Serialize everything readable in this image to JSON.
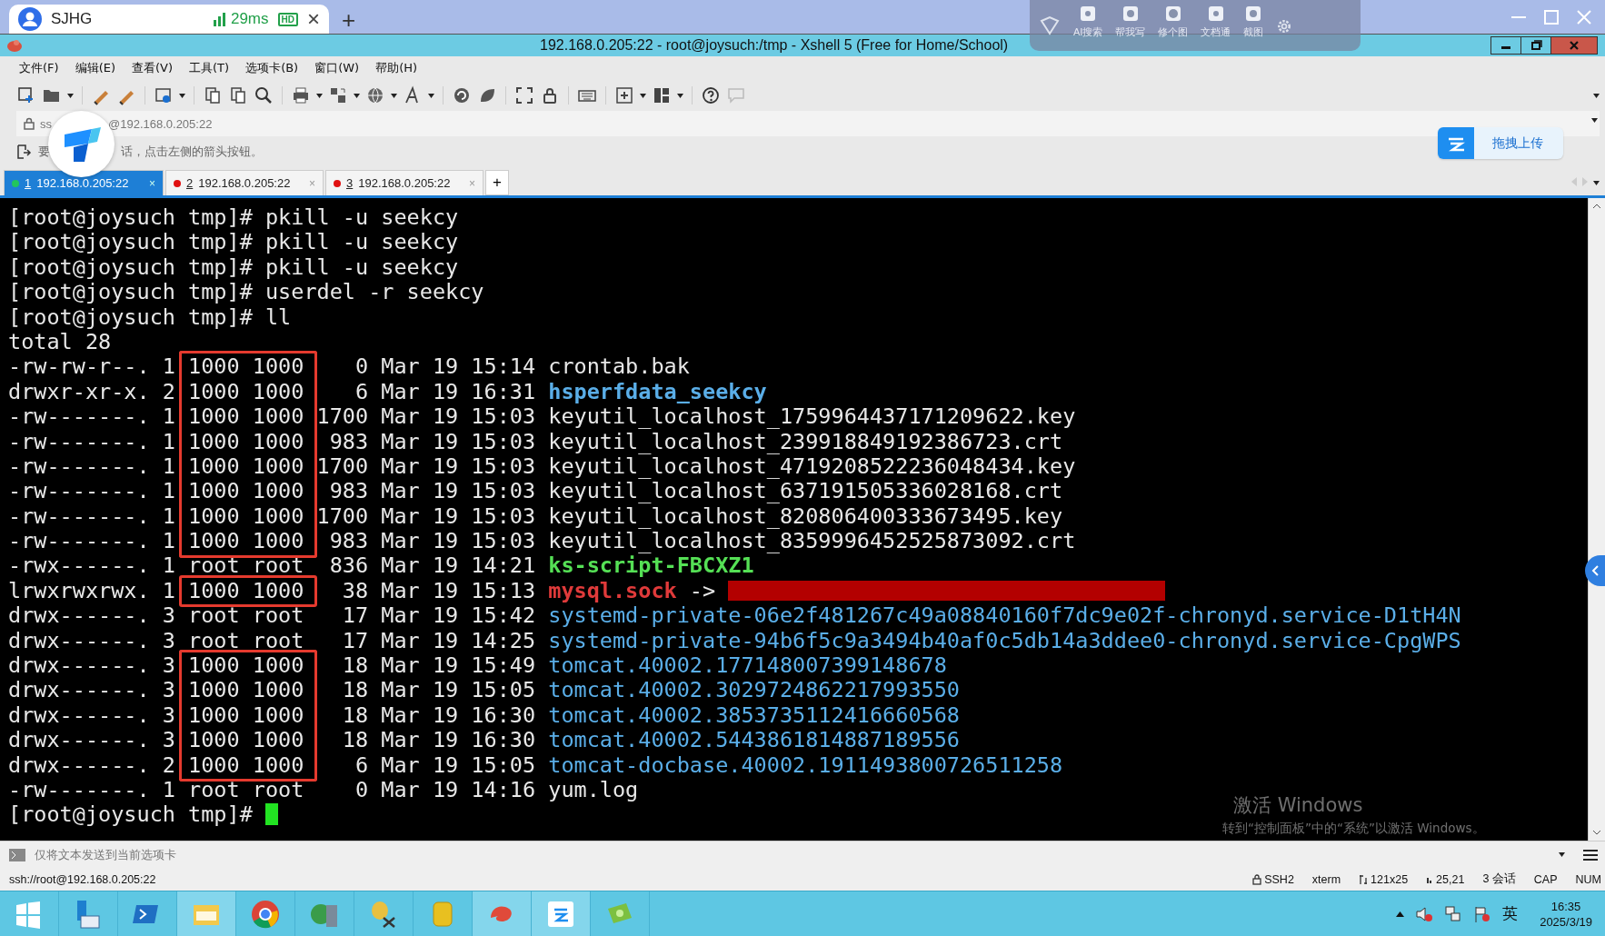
{
  "browser_tab": {
    "title": "SJHG",
    "latency": "29ms",
    "quality_badge": "HD",
    "close": "×",
    "new_tab": "+"
  },
  "overlay_toolbar": {
    "items": [
      "AI搜索",
      "帮我写",
      "修个图",
      "文档通",
      "截图"
    ]
  },
  "window": {
    "title": "192.168.0.205:22 - root@joysuch:/tmp - Xshell 5 (Free for Home/School)"
  },
  "menu": [
    "文件(F)",
    "编辑(E)",
    "查看(V)",
    "工具(T)",
    "选项卡(B)",
    "窗口(W)",
    "帮助(H)"
  ],
  "address_bar": {
    "prefix": "ss",
    "address": "@192.168.0.205:22"
  },
  "hint_bar": {
    "lead": "要",
    "text": "话，点击左侧的箭头按钮。"
  },
  "upload_button": "拖拽上传",
  "session_tabs": [
    {
      "number": "1",
      "label": "192.168.0.205:22",
      "selected": true,
      "color": "#22c55e",
      "close": "×"
    },
    {
      "number": "2",
      "label": "192.168.0.205:22",
      "selected": false,
      "color": "#e01010",
      "close": "×"
    },
    {
      "number": "3",
      "label": "192.168.0.205:22",
      "selected": false,
      "color": "#e01010",
      "close": "×"
    }
  ],
  "new_session_tab": "+",
  "terminal": {
    "lines": [
      {
        "kind": "text",
        "text": "[root@joysuch tmp]# pkill -u seekcy"
      },
      {
        "kind": "text",
        "text": "[root@joysuch tmp]# pkill -u seekcy"
      },
      {
        "kind": "text",
        "text": "[root@joysuch tmp]# pkill -u seekcy"
      },
      {
        "kind": "text",
        "text": "[root@joysuch tmp]# userdel -r seekcy"
      },
      {
        "kind": "text",
        "text": "[root@joysuch tmp]# ll"
      },
      {
        "kind": "text",
        "text": "total 28"
      },
      {
        "kind": "entry",
        "details": "-rw-rw-r--. 1 1000 1000    0 Mar 19 15:14 ",
        "name": "crontab.bak",
        "color": "#e8e8e8",
        "bold": false,
        "boxed": true
      },
      {
        "kind": "entry",
        "details": "drwxr-xr-x. 2 1000 1000    6 Mar 19 16:31 ",
        "name": "hsperfdata_seekcy",
        "color": "#5aaee8",
        "bold": true,
        "boxed": true
      },
      {
        "kind": "entry",
        "details": "-rw-------. 1 1000 1000 1700 Mar 19 15:03 ",
        "name": "keyutil_localhost_1759964437171209622.key",
        "color": "#e8e8e8",
        "bold": false,
        "boxed": true
      },
      {
        "kind": "entry",
        "details": "-rw-------. 1 1000 1000  983 Mar 19 15:03 ",
        "name": "keyutil_localhost_239918849192386723.crt",
        "color": "#e8e8e8",
        "bold": false,
        "boxed": true
      },
      {
        "kind": "entry",
        "details": "-rw-------. 1 1000 1000 1700 Mar 19 15:03 ",
        "name": "keyutil_localhost_4719208522236048434.key",
        "color": "#e8e8e8",
        "bold": false,
        "boxed": true
      },
      {
        "kind": "entry",
        "details": "-rw-------. 1 1000 1000  983 Mar 19 15:03 ",
        "name": "keyutil_localhost_637191505336028168.crt",
        "color": "#e8e8e8",
        "bold": false,
        "boxed": true
      },
      {
        "kind": "entry",
        "details": "-rw-------. 1 1000 1000 1700 Mar 19 15:03 ",
        "name": "keyutil_localhost_820806400333673495.key",
        "color": "#e8e8e8",
        "bold": false,
        "boxed": true
      },
      {
        "kind": "entry",
        "details": "-rw-------. 1 1000 1000  983 Mar 19 15:03 ",
        "name": "keyutil_localhost_8359996452525873092.crt",
        "color": "#e8e8e8",
        "bold": false,
        "boxed": true
      },
      {
        "kind": "entry",
        "details": "-rwx------. 1 root root  836 Mar 19 14:21 ",
        "name": "ks-script-FBCXZ1",
        "color": "#55e055",
        "bold": true,
        "boxed": false
      },
      {
        "kind": "entry",
        "details": "lrwxrwxrwx. 1 1000 1000   38 Mar 19 15:13 ",
        "name": "mysql.sock",
        "color": "#e03a3a",
        "bold": true,
        "boxed": true,
        "arrow": " -> ",
        "target_redacted": true
      },
      {
        "kind": "entry",
        "details": "drwx------. 3 root root   17 Mar 19 15:42 ",
        "name": "systemd-private-06e2f481267c49a08840160f7dc9e02f-chronyd.service-D1tH4N",
        "color": "#5aaee8",
        "bold": false,
        "boxed": false
      },
      {
        "kind": "entry",
        "details": "drwx------. 3 root root   17 Mar 19 14:25 ",
        "name": "systemd-private-94b6f5c9a3494b40af0c5db14a3ddee0-chronyd.service-CpgWPS",
        "color": "#5aaee8",
        "bold": false,
        "boxed": false
      },
      {
        "kind": "entry",
        "details": "drwx------. 3 1000 1000   18 Mar 19 15:49 ",
        "name": "tomcat.40002.177148007399148678",
        "color": "#5aaee8",
        "bold": false,
        "boxed": true
      },
      {
        "kind": "entry",
        "details": "drwx------. 3 1000 1000   18 Mar 19 15:05 ",
        "name": "tomcat.40002.3029724862217993550",
        "color": "#5aaee8",
        "bold": false,
        "boxed": true
      },
      {
        "kind": "entry",
        "details": "drwx------. 3 1000 1000   18 Mar 19 16:30 ",
        "name": "tomcat.40002.3853735112416660568",
        "color": "#5aaee8",
        "bold": false,
        "boxed": true
      },
      {
        "kind": "entry",
        "details": "drwx------. 3 1000 1000   18 Mar 19 16:30 ",
        "name": "tomcat.40002.5443861814887189556",
        "color": "#5aaee8",
        "bold": false,
        "boxed": true
      },
      {
        "kind": "entry",
        "details": "drwx------. 2 1000 1000    6 Mar 19 15:05 ",
        "name": "tomcat-docbase.40002.1911493800726511258",
        "color": "#5aaee8",
        "bold": false,
        "boxed": true
      },
      {
        "kind": "entry",
        "details": "-rw-------. 1 root root    0 Mar 19 14:16 ",
        "name": "yum.log",
        "color": "#e8e8e8",
        "bold": false,
        "boxed": false
      },
      {
        "kind": "prompt",
        "text": "[root@joysuch tmp]#",
        "cursor": true
      }
    ]
  },
  "os_notice": {
    "title": "激活 Windows",
    "text": "转到“控制面板”中的“系统”以激活 Windows。"
  },
  "send_bar": {
    "text": "仅将文本发送到当前选项卡"
  },
  "status_bar": {
    "connection": "ssh://root@192.168.0.205:22",
    "items": [
      {
        "kind": "lock",
        "text": "SSH2"
      },
      {
        "kind": "plain",
        "text": "xterm"
      },
      {
        "kind": "size",
        "text": "121x25"
      },
      {
        "kind": "cursor",
        "text": "25,21"
      },
      {
        "kind": "plain",
        "text": "3 会话"
      },
      {
        "kind": "plain",
        "text": "CAP"
      },
      {
        "kind": "plain",
        "text": "NUM"
      }
    ]
  },
  "taskbar": {
    "language": "英",
    "time": "16:35",
    "date": "2025/3/19"
  }
}
